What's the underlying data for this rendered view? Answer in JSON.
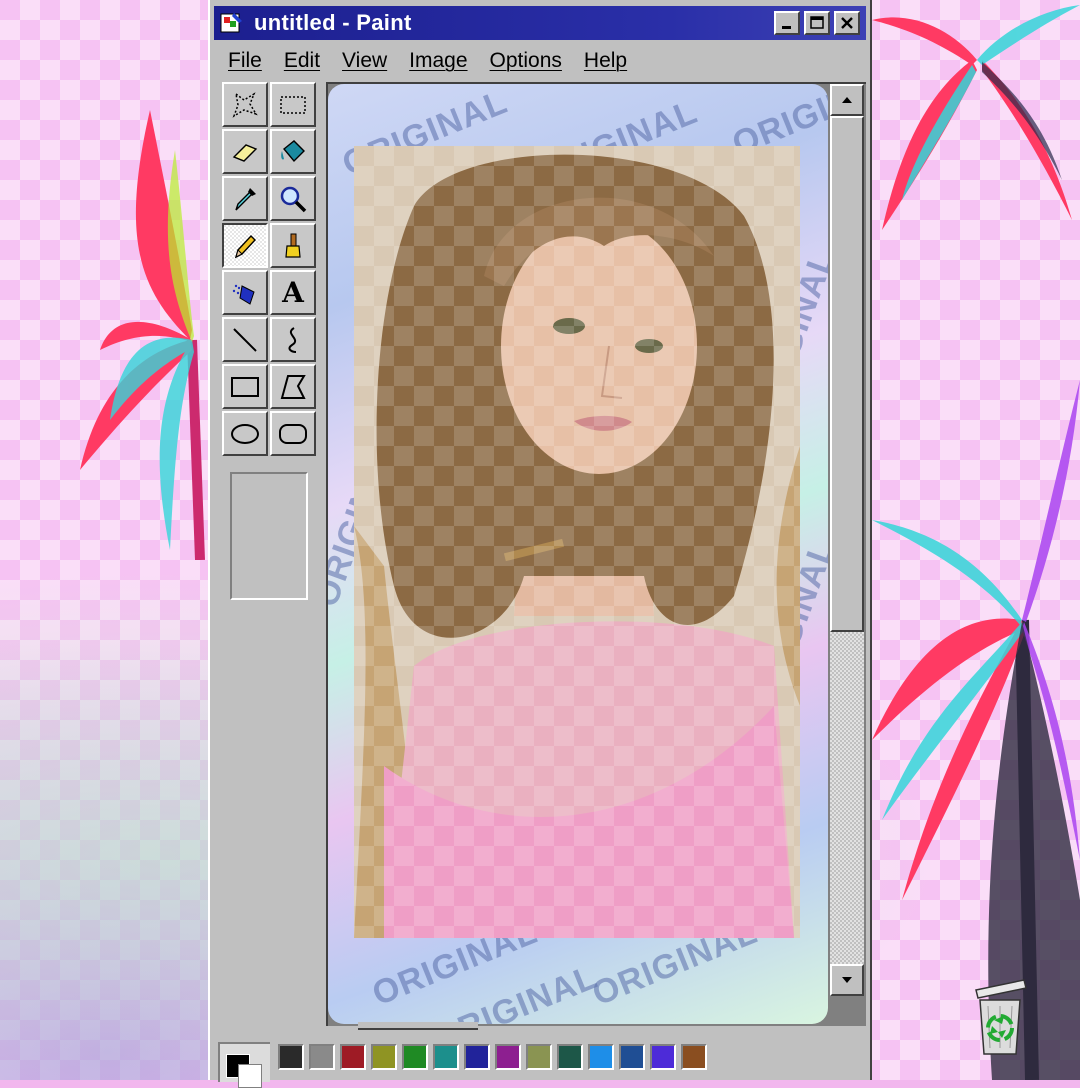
{
  "window": {
    "title": "untitled - Paint",
    "controls": [
      "minimize",
      "maximize",
      "close"
    ]
  },
  "menu": {
    "items": [
      "File",
      "Edit",
      "View",
      "Image",
      "Options",
      "Help"
    ]
  },
  "toolbox": {
    "tools": [
      "free-form-select",
      "rectangle-select",
      "eraser",
      "fill-with-color",
      "pick-color",
      "magnifier",
      "pencil",
      "brush",
      "airbrush",
      "text",
      "line",
      "curve",
      "rectangle",
      "polygon",
      "ellipse",
      "rounded-rectangle"
    ],
    "active_tool": "pencil",
    "text_tool_glyph": "A"
  },
  "canvas": {
    "watermark_text": "ORIGINAL"
  },
  "palette": {
    "foreground": "#000000",
    "background": "#ffffff",
    "swatches": [
      "#2a2a2a",
      "#8a8a8a",
      "#9e1b25",
      "#8f9423",
      "#1f8a24",
      "#1c8f8c",
      "#21239a",
      "#8d1f90",
      "#8a9452",
      "#1d5748",
      "#1e8ee8",
      "#1f4e94",
      "#4d2bd8",
      "#8a4e20"
    ]
  },
  "colors": {
    "titlebar": "#1c1f8f",
    "window_face": "#c0c0c0",
    "desktop": "#f6c3f3"
  }
}
